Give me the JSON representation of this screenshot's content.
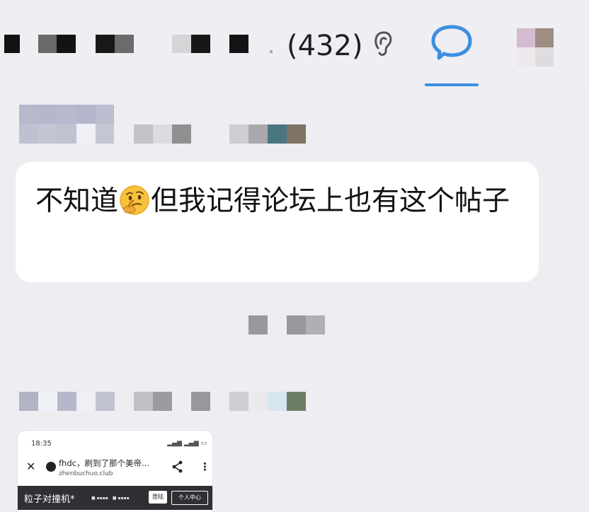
{
  "header": {
    "count": "(432)",
    "accent": "#3d8fe0"
  },
  "message": {
    "text_before": "不知道",
    "emoji": "thinking-face",
    "text_after": "但我记得论坛上也有这个帖子"
  },
  "shared_image": {
    "status_time": "18:35",
    "title": "fhdc，刷到了那个美帝...",
    "url": "zhenbuchuo.club",
    "page_title": "粒子对撞机*",
    "login_label": "登陆",
    "profile_label": "个人中心"
  }
}
